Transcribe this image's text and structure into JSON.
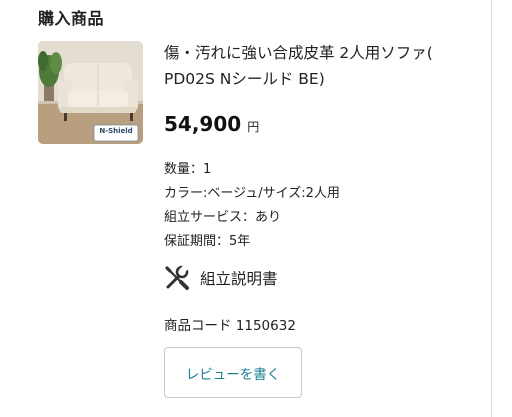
{
  "section": {
    "title": "購入商品"
  },
  "product": {
    "name": "傷・汚れに強い合成皮革 2人用ソファ( PD02S Nシールド BE)",
    "image_badge_text": "N-Shield",
    "price": {
      "amount": "54,900",
      "unit": "円"
    },
    "specs": [
      "数量：1",
      "カラー:ベージュ/サイズ:2人用",
      "組立サービス：あり",
      "保証期間：5年"
    ],
    "assembly_link": {
      "label": "組立説明書",
      "icon": "tools-icon"
    },
    "code": "商品コード 1150632",
    "review_button": {
      "label": "レビューを書く"
    }
  },
  "colors": {
    "link_teal": "#1a7f8e",
    "border": "#c8c8c8",
    "text": "#222222"
  }
}
